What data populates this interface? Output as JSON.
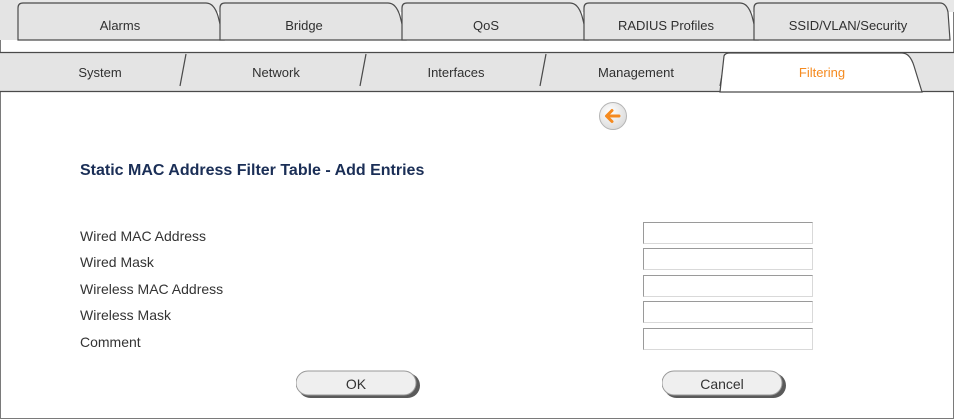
{
  "tabs_back": [
    {
      "label": "Alarms"
    },
    {
      "label": "Bridge"
    },
    {
      "label": "QoS"
    },
    {
      "label": "RADIUS Profiles"
    },
    {
      "label": "SSID/VLAN/Security"
    }
  ],
  "tabs_front": [
    {
      "label": "System",
      "active": false
    },
    {
      "label": "Network",
      "active": false
    },
    {
      "label": "Interfaces",
      "active": false
    },
    {
      "label": "Management",
      "active": false
    },
    {
      "label": "Filtering",
      "active": true
    }
  ],
  "back_button": {
    "icon": "arrow-left-icon",
    "color": "#f58a1f"
  },
  "page_title": "Static MAC Address Filter Table - Add Entries",
  "fields": [
    {
      "label": "Wired MAC Address",
      "value": ""
    },
    {
      "label": "Wired Mask",
      "value": ""
    },
    {
      "label": "Wireless MAC Address",
      "value": ""
    },
    {
      "label": "Wireless Mask",
      "value": ""
    },
    {
      "label": "Comment",
      "value": ""
    }
  ],
  "buttons": {
    "ok": "OK",
    "cancel": "Cancel"
  },
  "colors": {
    "accent": "#f58a1f",
    "tab_fill": "#e4e4e4",
    "title": "#1a2e56"
  }
}
